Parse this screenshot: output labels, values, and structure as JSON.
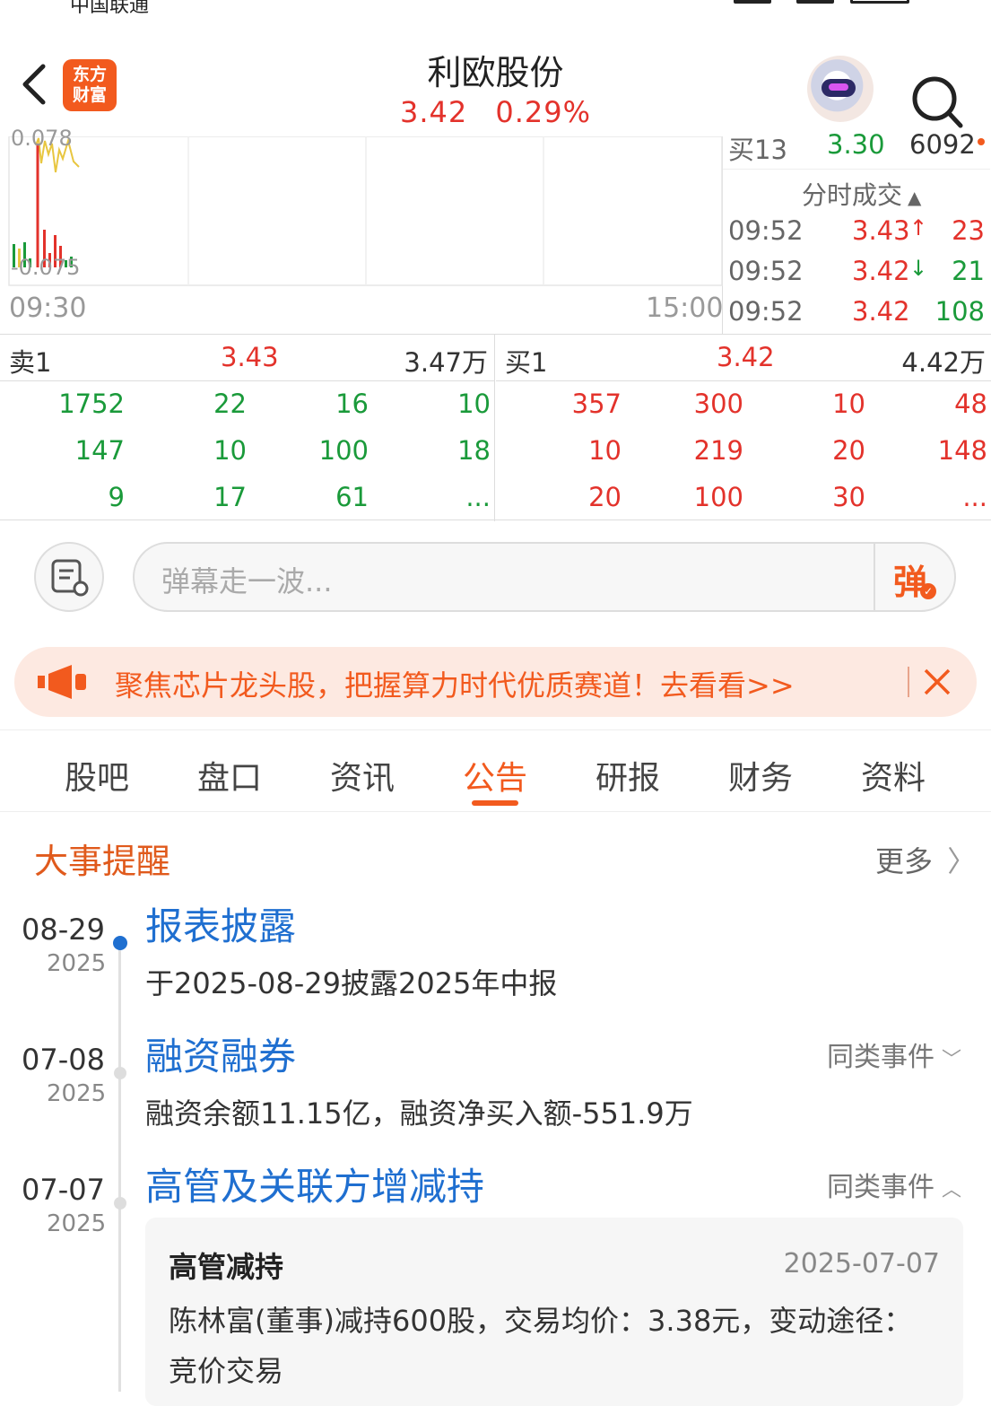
{
  "status": {
    "carrier": "中国联通"
  },
  "header": {
    "title": "利欧股份",
    "price": "3.42",
    "change": "0.29%",
    "logo_line1": "东方",
    "logo_line2": "财富"
  },
  "chart": {
    "y_top": "0.078",
    "y_bottom": "-0.075",
    "time_start": "09:30",
    "time_end": "15:00"
  },
  "orderbook_top": {
    "label": "买13",
    "price": "3.30",
    "volume": "6092"
  },
  "ticks": {
    "title": "分时成交",
    "rows": [
      {
        "time": "09:52",
        "price": "3.43",
        "arrow": "↑",
        "vol": "23"
      },
      {
        "time": "09:52",
        "price": "3.42",
        "arrow": "↓",
        "vol": "21"
      },
      {
        "time": "09:52",
        "price": "3.42",
        "arrow": "",
        "vol": "108"
      }
    ]
  },
  "book": {
    "sell": {
      "label": "卖1",
      "price": "3.43",
      "volume": "3.47万",
      "rows": [
        [
          "1752",
          "22",
          "16",
          "10"
        ],
        [
          "147",
          "10",
          "100",
          "18"
        ],
        [
          "9",
          "17",
          "61",
          "..."
        ]
      ]
    },
    "buy": {
      "label": "买1",
      "price": "3.42",
      "volume": "4.42万",
      "rows": [
        [
          "357",
          "300",
          "10",
          "48"
        ],
        [
          "10",
          "219",
          "20",
          "148"
        ],
        [
          "20",
          "100",
          "30",
          "..."
        ]
      ]
    }
  },
  "danmu": {
    "placeholder": "弹幕走一波...",
    "send_label": "弹"
  },
  "banner": {
    "text": "聚焦芯片龙头股，把握算力时代优质赛道！去看看>>"
  },
  "tabs": [
    "股吧",
    "盘口",
    "资讯",
    "公告",
    "研报",
    "财务",
    "资料"
  ],
  "active_tab": 3,
  "events": {
    "section_title": "大事提醒",
    "more_label": "更多",
    "items": [
      {
        "date": "08-29",
        "year": "2025",
        "title": "报表披露",
        "desc": "于2025-08-29披露2025年中报",
        "similar": ""
      },
      {
        "date": "07-08",
        "year": "2025",
        "title": "融资融券",
        "desc": "融资余额11.15亿，融资净买入额-551.9万",
        "similar": "同类事件"
      },
      {
        "date": "07-07",
        "year": "2025",
        "title": "高管及关联方增减持",
        "desc": "",
        "similar": "同类事件"
      }
    ],
    "detail": {
      "title": "高管减持",
      "date": "2025-07-07",
      "text1": "陈林富(董事)减持600股，交易均价：3.38元，变动途径：",
      "text2": "竞价交易"
    }
  },
  "colors": {
    "up": "#e3322b",
    "down": "#1a9a3a",
    "accent": "#f25a1e",
    "link": "#1f6fd0"
  }
}
